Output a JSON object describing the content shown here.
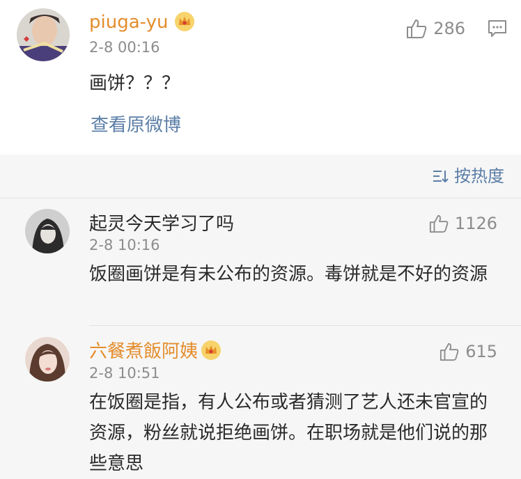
{
  "post": {
    "username": "piuga-yu",
    "time": "2-8 00:16",
    "likes": "286",
    "text": "画饼？？？",
    "view_original": "查看原微博"
  },
  "sort": {
    "label": "按热度"
  },
  "comments": [
    {
      "username": "起灵今天学习了吗",
      "time": "2-8 10:16",
      "likes": "1126",
      "text": "饭圈画饼是有未公布的资源。毒饼就是不好的资源"
    },
    {
      "username": "六餐煮飯阿姨",
      "time": "2-8 10:51",
      "likes": "615",
      "text": "在饭圈是指，有人公布或者猜测了艺人还未官宣的资源，粉丝就说拒绝画饼。在职场就是他们说的那些意思"
    }
  ],
  "colors": {
    "username_highlight": "#e48d2c",
    "link": "#5b7ea7",
    "meta": "#8c8c8c",
    "text": "#2a2a2a"
  }
}
